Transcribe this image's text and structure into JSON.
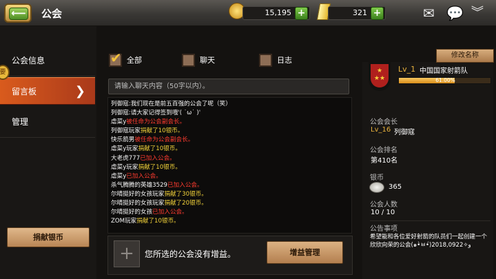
{
  "header": {
    "title": "公会"
  },
  "resources": {
    "gold": "15,195",
    "gems": "321"
  },
  "sidebar": {
    "items": [
      {
        "label": "公会信息"
      },
      {
        "label": "留言板"
      },
      {
        "label": "管理"
      }
    ],
    "badge_text": "要",
    "donate_label": "捐献银币"
  },
  "filters": [
    {
      "label": "全部",
      "checked": true
    },
    {
      "label": "聊天",
      "checked": false
    },
    {
      "label": "日志",
      "checked": false
    }
  ],
  "input": {
    "placeholder": "请输入聊天内容（50字以内）。"
  },
  "chat": [
    [
      {
        "t": "列御寇",
        "c": "w"
      },
      {
        "t": ":我们现在是前五百强的公会了呢（笑）",
        "c": "w"
      }
    ],
    [
      {
        "t": "列御寇",
        "c": "w"
      },
      {
        "t": ":请大家记得签到哦'( ˙ω˙ )'",
        "c": "w"
      }
    ],
    [
      {
        "t": "虐菜y",
        "c": "w"
      },
      {
        "t": "被任命为公会副会长。",
        "c": "r"
      }
    ],
    [
      {
        "t": "列御寇玩家",
        "c": "w"
      },
      {
        "t": "捐献了10银币。",
        "c": "y"
      }
    ],
    [
      {
        "t": "快乐箭男",
        "c": "w"
      },
      {
        "t": "被任命为公会副会长。",
        "c": "r"
      }
    ],
    [
      {
        "t": "虐菜y玩家",
        "c": "w"
      },
      {
        "t": "捐献了10银币。",
        "c": "y"
      }
    ],
    [
      {
        "t": "大老虎777",
        "c": "w"
      },
      {
        "t": "已加入公会。",
        "c": "r"
      }
    ],
    [
      {
        "t": "虐菜y玩家",
        "c": "w"
      },
      {
        "t": "捐献了10银币。",
        "c": "y"
      }
    ],
    [
      {
        "t": "虐菜y",
        "c": "w"
      },
      {
        "t": "已加入公会。",
        "c": "r"
      }
    ],
    [
      {
        "t": "杀气腾腾的英雄3529",
        "c": "w"
      },
      {
        "t": "已加入公会。",
        "c": "r"
      }
    ],
    [
      {
        "t": "尔晴挺好的女孩玩家",
        "c": "w"
      },
      {
        "t": "捐献了30银币。",
        "c": "y"
      }
    ],
    [
      {
        "t": "尔晴挺好的女孩玩家",
        "c": "w"
      },
      {
        "t": "捐献了20银币。",
        "c": "y"
      }
    ],
    [
      {
        "t": "尔晴挺好的女孩",
        "c": "w"
      },
      {
        "t": "已加入公会。",
        "c": "r"
      }
    ],
    [
      {
        "t": "ZOM玩家",
        "c": "w"
      },
      {
        "t": "捐献了10银币。",
        "c": "y"
      }
    ]
  ],
  "bonus": {
    "text": "您所选的公会没有增益。",
    "button_label": "增益管理"
  },
  "guild": {
    "rename_label": "修改名称",
    "level": "Lv_1",
    "name": "中国国家射箭队",
    "progress_text": "61.00%",
    "progress": 0.61,
    "leader_label": "公会会长",
    "leader_level": "Lv_16",
    "leader_name": "列御寇",
    "rank_label": "公会排名",
    "rank_value": "第410名",
    "silver_label": "银币",
    "silver_value": "365",
    "members_label": "公会人数",
    "members_value": "10 / 10",
    "notice_label": "公告事项",
    "notice_text": "希望能和各位爱好射箭的队员们一起创建一个欣欣向荣的公会(๑•̀ㅂ•́)و✧2018,0922"
  },
  "colors": {
    "accent": "#d95b1d",
    "gold": "#f2d23a",
    "alert": "#ff3b2f"
  }
}
